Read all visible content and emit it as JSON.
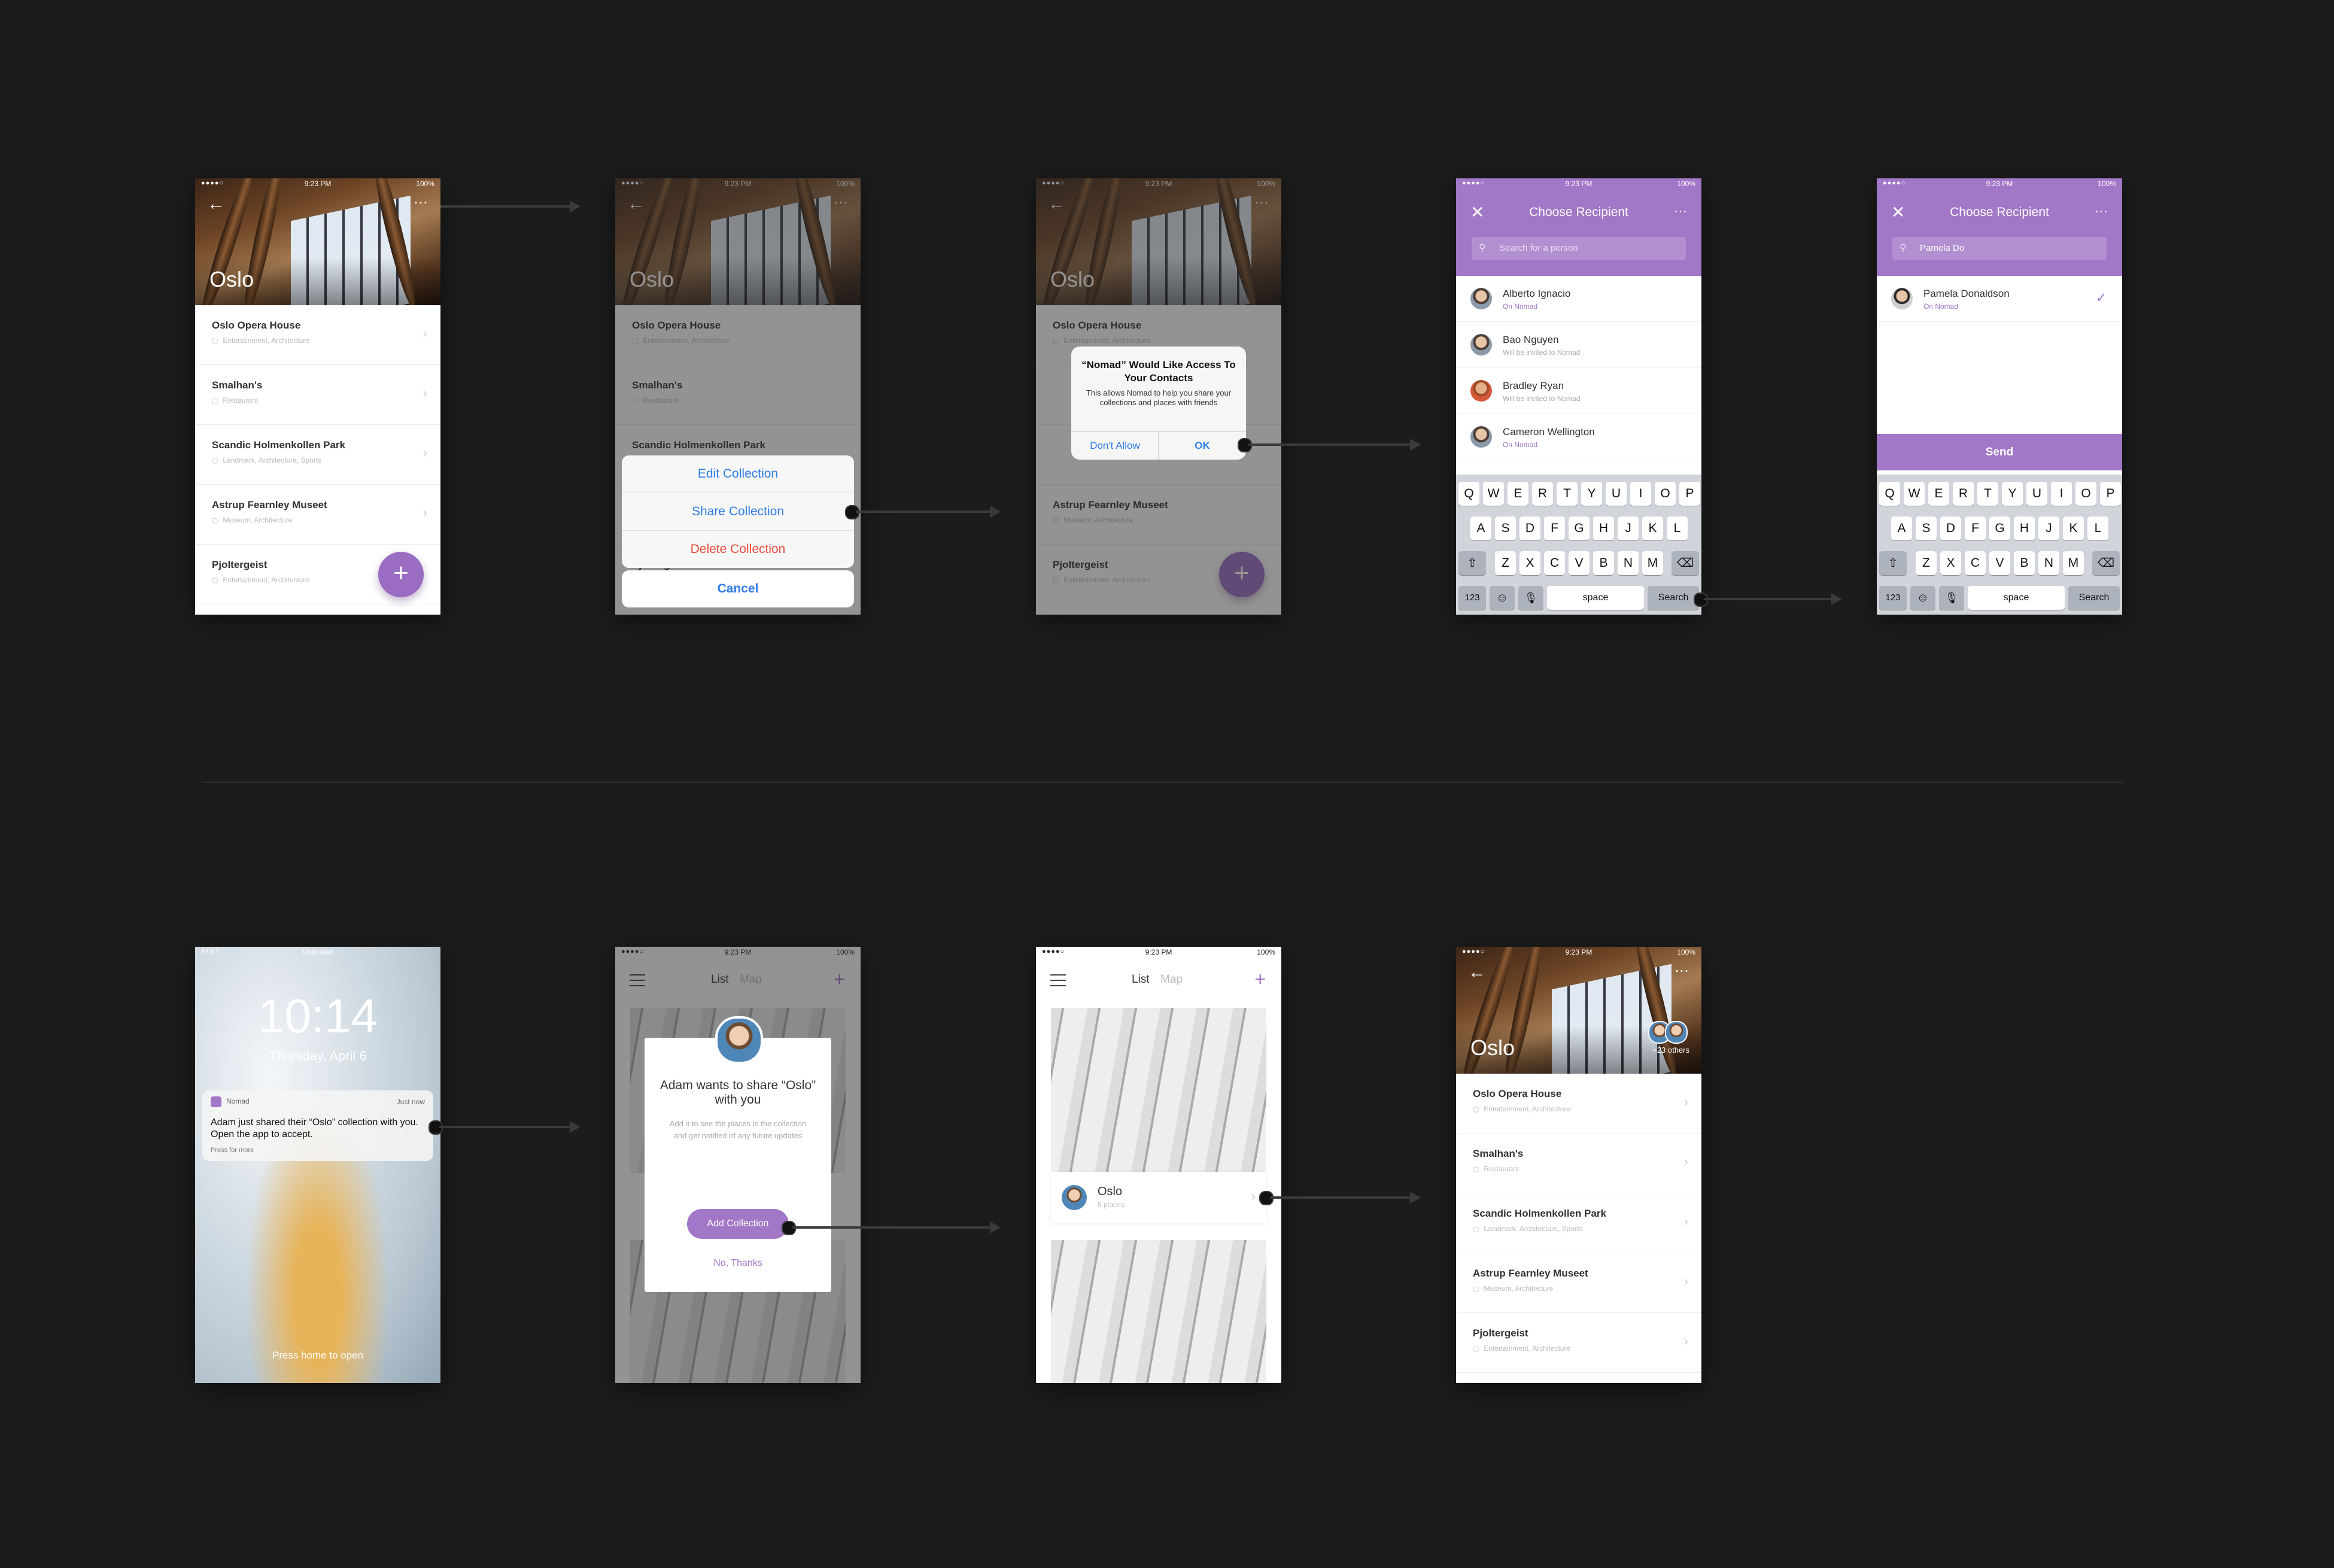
{
  "status": {
    "time": "9:23 PM",
    "battery": "100%",
    "signal": "●●●●○"
  },
  "collection": {
    "city": "Oslo",
    "places": [
      {
        "name": "Oslo Opera House",
        "tags": "Entertainment, Architecture"
      },
      {
        "name": "Smalhan's",
        "tags": "Restaurant"
      },
      {
        "name": "Scandic Holmenkollen Park",
        "tags": "Landmark, Architecture, Sports"
      },
      {
        "name": "Astrup Fearnley Museet",
        "tags": "Museum, Architecture"
      },
      {
        "name": "Pjoltergeist",
        "tags": "Entertainment, Architecture"
      }
    ]
  },
  "action_sheet": {
    "edit": "Edit Collection",
    "share": "Share Collection",
    "delete": "Delete Collection",
    "cancel": "Cancel"
  },
  "alert": {
    "title": "“Nomad” Would Like Access To Your Contacts",
    "message": "This allows Nomad to help you share your collections and places with friends",
    "deny": "Don't Allow",
    "ok": "OK"
  },
  "recipient": {
    "title": "Choose Recipient",
    "placeholder": "Search for a person",
    "query": "Pamela Do",
    "contacts": [
      {
        "name": "Alberto Ignacio",
        "status": "On Nomad"
      },
      {
        "name": "Bao Nguyen",
        "status": "Will be invited to Nomad"
      },
      {
        "name": "Bradley Ryan",
        "status": "Will be invited to Nomad"
      },
      {
        "name": "Cameron Wellington",
        "status": "On Nomad"
      }
    ],
    "selected": {
      "name": "Pamela Donaldson",
      "status": "On Nomad"
    },
    "send": "Send"
  },
  "keyboard": {
    "row1": [
      "Q",
      "W",
      "E",
      "R",
      "T",
      "Y",
      "U",
      "I",
      "O",
      "P"
    ],
    "row2": [
      "A",
      "S",
      "D",
      "F",
      "G",
      "H",
      "J",
      "K",
      "L"
    ],
    "row3": [
      "Z",
      "X",
      "C",
      "V",
      "B",
      "N",
      "M"
    ],
    "numbers": "123",
    "space": "space",
    "search": "Search",
    "shift": "⇧",
    "delete": "⌫",
    "emoji": "☺",
    "mic": "🎙"
  },
  "lockscreen": {
    "carrier": "AT&T",
    "lock": "Unlocked",
    "time": "10:14",
    "date": "Thursday, April 6",
    "app": "Nomad",
    "when": "Just now",
    "message": "Adam just shared their “Oslo” collection with you. Open the app to accept.",
    "more": "Press for more",
    "unlock": "Press home to open"
  },
  "home": {
    "tab_list": "List",
    "tab_map": "Map",
    "invite_title": "Adam wants to share “Oslo” with you",
    "invite_body": "Add it to see the places in the collection and get notified of any future updates",
    "add": "Add Collection",
    "decline": "No, Thanks",
    "city_name": "Oslo",
    "city_places": "5 places"
  },
  "shared": {
    "others": "+23 others"
  },
  "colors": {
    "accent": "#a277c7",
    "link": "#2f7ce6",
    "destructive": "#e54b3d"
  }
}
